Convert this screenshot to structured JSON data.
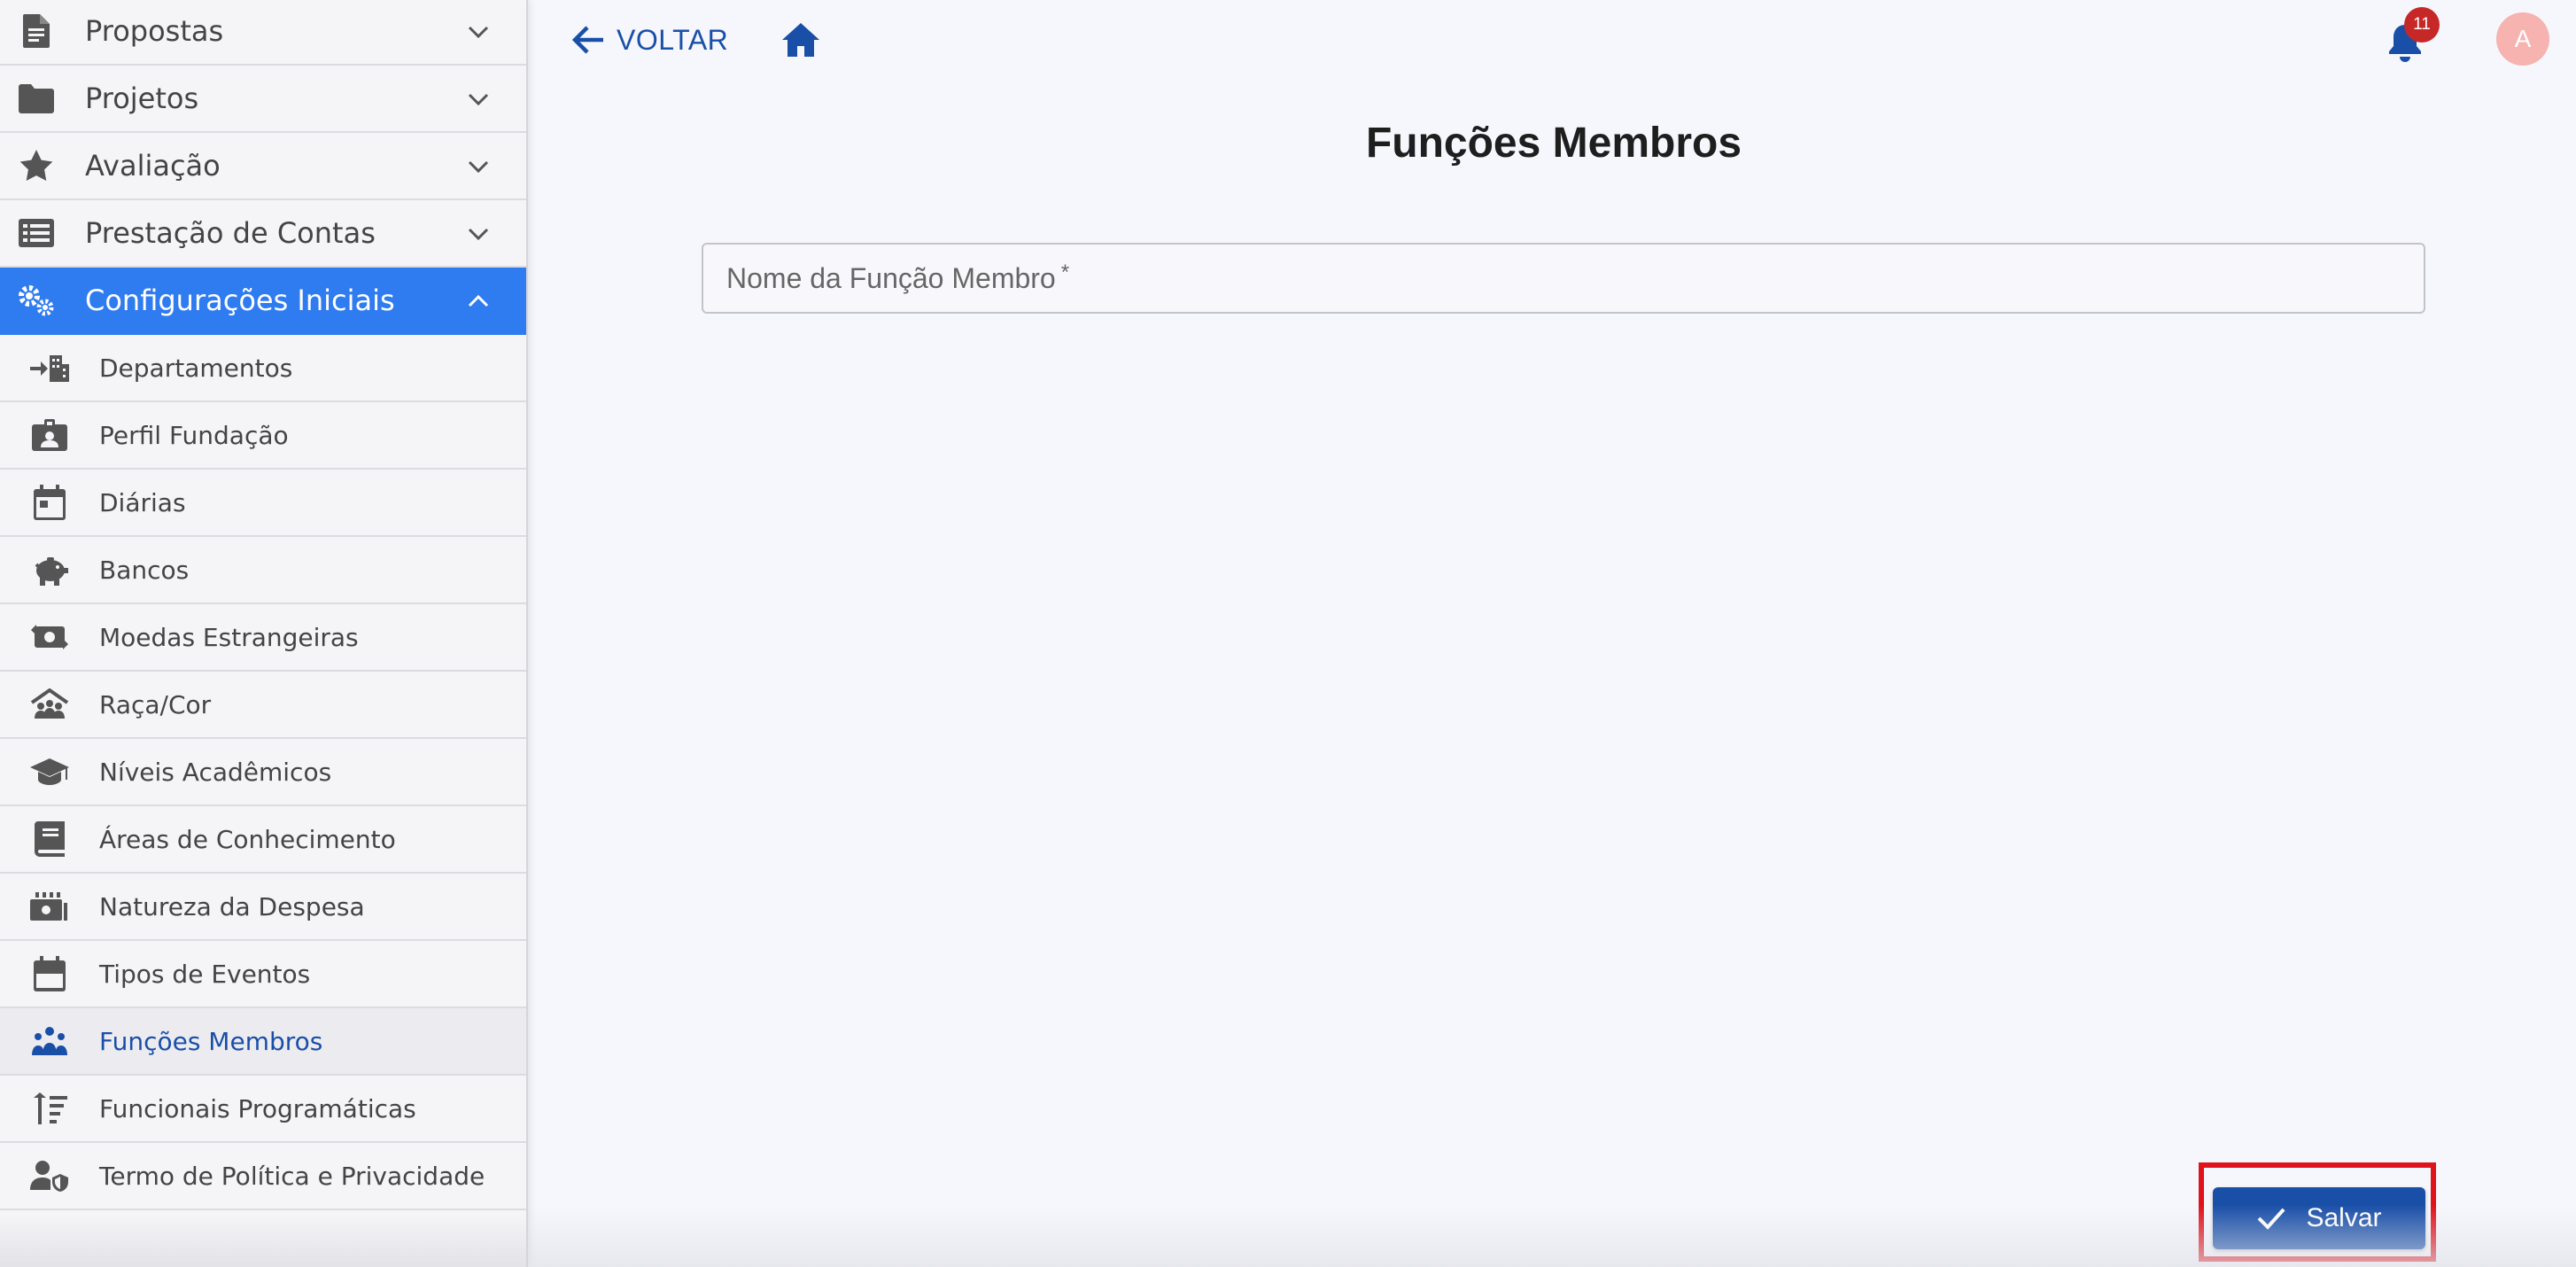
{
  "sidebar": {
    "top_items": [
      {
        "label": "Propostas",
        "icon": "document-icon"
      },
      {
        "label": "Projetos",
        "icon": "folder-icon"
      },
      {
        "label": "Avaliação",
        "icon": "star-icon"
      },
      {
        "label": "Prestação de Contas",
        "icon": "list-icon"
      },
      {
        "label": "Configurações Iniciais",
        "icon": "gears-icon",
        "expanded": true
      }
    ],
    "sub_items": [
      {
        "label": "Departamentos",
        "icon": "department-icon"
      },
      {
        "label": "Perfil Fundação",
        "icon": "id-badge-icon"
      },
      {
        "label": "Diárias",
        "icon": "calendar-icon"
      },
      {
        "label": "Bancos",
        "icon": "piggy-bank-icon"
      },
      {
        "label": "Moedas Estrangeiras",
        "icon": "money-exchange-icon"
      },
      {
        "label": "Raça/Cor",
        "icon": "people-roof-icon"
      },
      {
        "label": "Níveis Acadêmicos",
        "icon": "graduation-cap-icon"
      },
      {
        "label": "Áreas de Conhecimento",
        "icon": "book-icon"
      },
      {
        "label": "Natureza da Despesa",
        "icon": "money-bills-icon"
      },
      {
        "label": "Tipos de Eventos",
        "icon": "calendar-event-icon"
      },
      {
        "label": "Funções Membros",
        "icon": "people-group-icon",
        "selected": true
      },
      {
        "label": "Funcionais Programáticas",
        "icon": "sort-amount-up-icon"
      },
      {
        "label": "Termo de Política e Privacidade",
        "icon": "user-shield-icon"
      }
    ]
  },
  "topbar": {
    "back_label": "VOLTAR",
    "notification_count": "11",
    "avatar_initial": "A"
  },
  "main": {
    "title": "Funções Membros",
    "field": {
      "label": "Nome da Função Membro",
      "required_mark": "*",
      "value": ""
    },
    "save_label": "Salvar"
  },
  "colors": {
    "accent": "#2f7bf0",
    "primary": "#1a4fa8",
    "badge": "#c62828",
    "avatar": "#f6b3b0",
    "highlight_outline": "#e0121c"
  }
}
